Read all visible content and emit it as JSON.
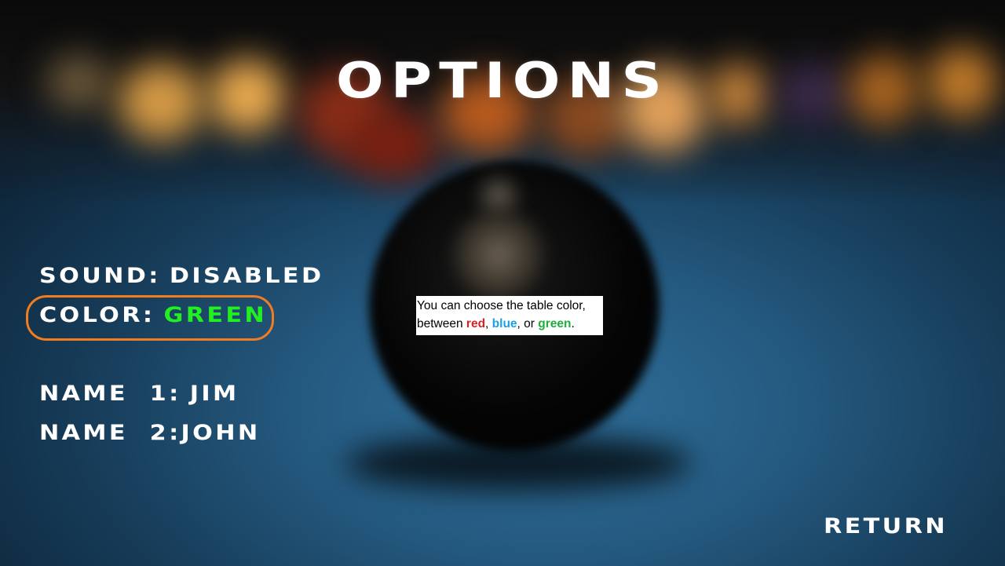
{
  "menu": {
    "title": "OPTIONS",
    "sound": {
      "label": "SOUND:",
      "value": "DISABLED"
    },
    "color": {
      "label": "COLOR:",
      "value": "GREEN",
      "value_color": "#22ee22"
    },
    "name1": {
      "label": "NAME  1:",
      "value": "JIM"
    },
    "name2": {
      "label": "NAME  2:",
      "value": "JOHN"
    },
    "return_label": "RETURN",
    "highlight_color": "#f07d22"
  },
  "tooltip": {
    "line1": "You can choose the table color,",
    "line2_prefix": "between ",
    "red": "red",
    "sep1": ", ",
    "blue": "blue",
    "sep2": ", or ",
    "green": "green",
    "end": "."
  },
  "icons": {
    "background": "blurred-eight-ball-on-pool-table"
  }
}
